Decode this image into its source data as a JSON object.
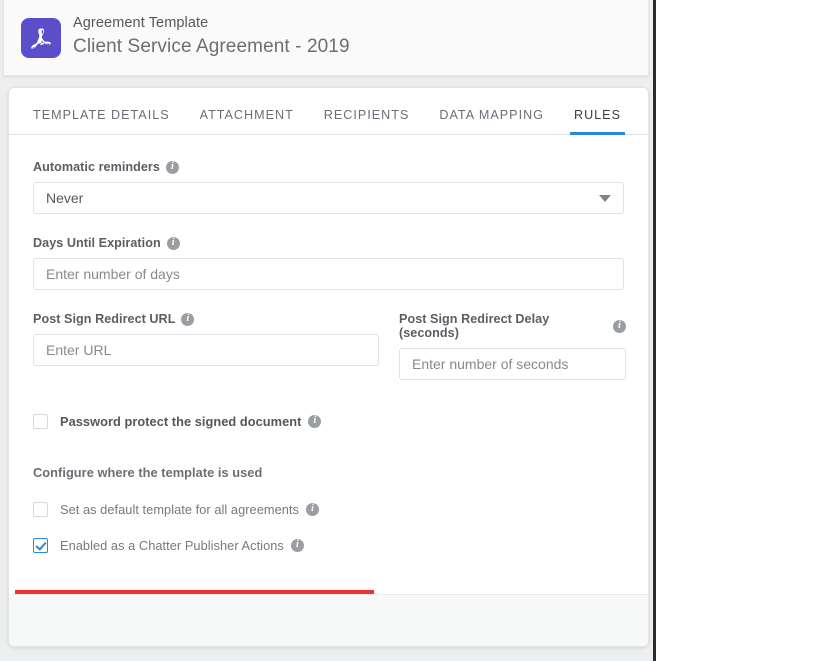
{
  "header": {
    "icon": "pdf-document-icon",
    "eyebrow": "Agreement Template",
    "title": "Client Service Agreement - 2019"
  },
  "tabs": [
    {
      "label": "TEMPLATE DETAILS",
      "active": false
    },
    {
      "label": "ATTACHMENT",
      "active": false
    },
    {
      "label": "RECIPIENTS",
      "active": false
    },
    {
      "label": "DATA MAPPING",
      "active": false
    },
    {
      "label": "RULES",
      "active": true
    }
  ],
  "form": {
    "automatic_reminders": {
      "label": "Automatic reminders",
      "info_icon": "info-icon",
      "value": "Never",
      "caret_icon": "chevron-down-icon"
    },
    "days_until_expiration": {
      "label": "Days Until Expiration",
      "info_icon": "info-icon",
      "value": "",
      "placeholder": "Enter number of days"
    },
    "post_sign_redirect_url": {
      "label": "Post Sign Redirect URL",
      "info_icon": "info-icon",
      "value": "",
      "placeholder": "Enter URL"
    },
    "post_sign_redirect_delay": {
      "label": "Post Sign Redirect Delay (seconds)",
      "info_icon": "info-icon",
      "value": "",
      "placeholder": "Enter number of seconds"
    },
    "password_protect": {
      "label": "Password protect the signed document",
      "info_icon": "info-icon",
      "checked": false
    },
    "configure_section": {
      "heading": "Configure where the template is used",
      "set_default": {
        "label": "Set as default template for all agreements",
        "info_icon": "info-icon",
        "checked": false
      },
      "chatter_publisher": {
        "label": "Enabled as a Chatter Publisher Actions",
        "info_icon": "info-icon",
        "checked": true
      }
    }
  },
  "annotation": {
    "highlight_color": "#f0322e",
    "target": "Enabled as a Chatter Publisher Actions"
  },
  "colors": {
    "accent_blue": "#2a87d8",
    "pdf_icon_purple": "#5a4ecb",
    "page_background": "#eceef0",
    "card_background": "#ffffff"
  }
}
